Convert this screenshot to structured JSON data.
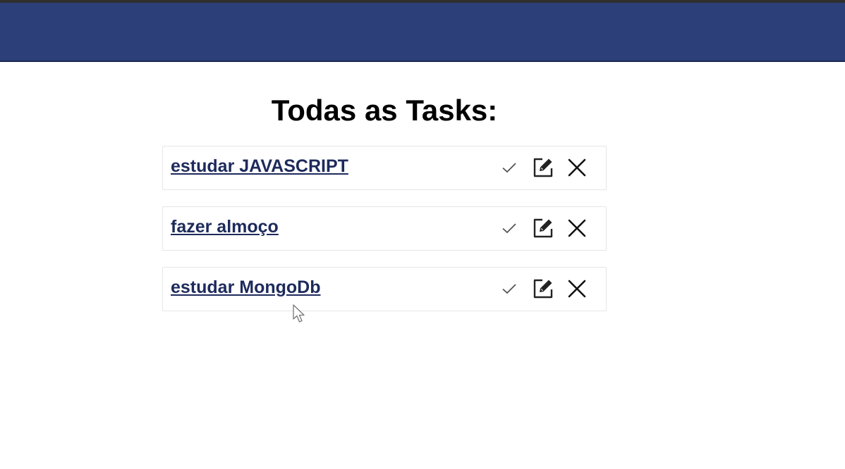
{
  "header": {
    "bar_color": "#2c3f78"
  },
  "page": {
    "title": "Todas as Tasks:"
  },
  "tasks": [
    {
      "title": "estudar JAVASCRIPT",
      "icons": [
        "check-icon",
        "edit-icon",
        "close-icon"
      ]
    },
    {
      "title": "fazer almoço",
      "icons": [
        "check-icon",
        "edit-icon",
        "close-icon"
      ]
    },
    {
      "title": "estudar MongoDb",
      "icons": [
        "check-icon",
        "edit-icon",
        "close-icon"
      ]
    }
  ],
  "colors": {
    "link": "#1d2a5c",
    "card_border": "#e6e6e6",
    "icon": "#222222"
  }
}
